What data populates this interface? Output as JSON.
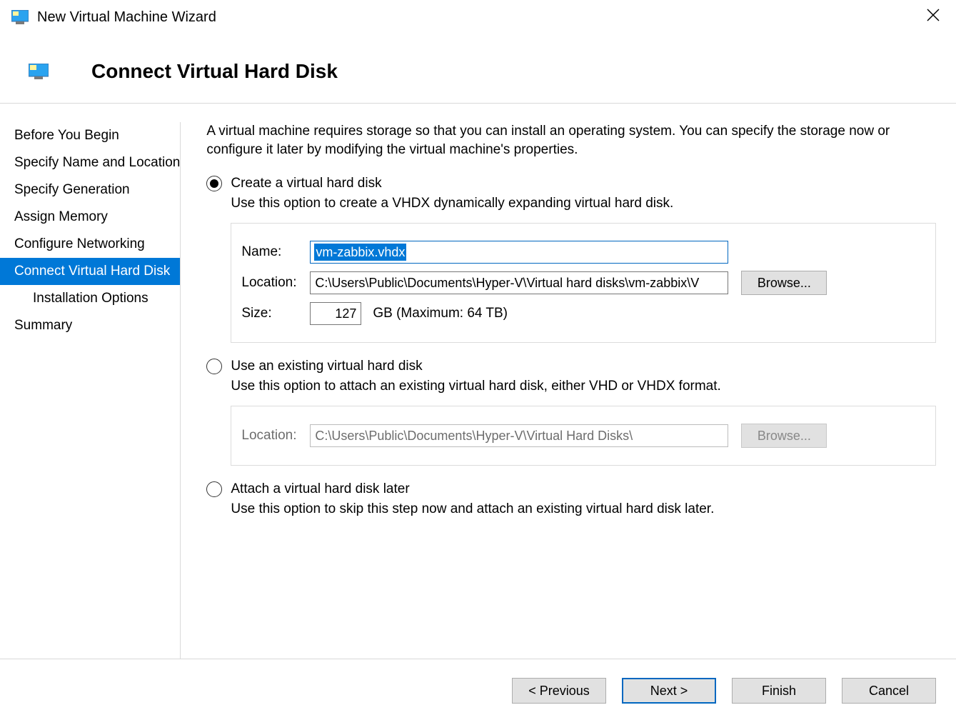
{
  "window": {
    "title": "New Virtual Machine Wizard"
  },
  "header": {
    "page_title": "Connect Virtual Hard Disk"
  },
  "sidebar": {
    "items": [
      "Before You Begin",
      "Specify Name and Location",
      "Specify Generation",
      "Assign Memory",
      "Configure Networking",
      "Connect Virtual Hard Disk",
      "Installation Options",
      "Summary"
    ],
    "selected_index": 5,
    "sub_index": 6
  },
  "content": {
    "intro": "A virtual machine requires storage so that you can install an operating system. You can specify the storage now or configure it later by modifying the virtual machine's properties.",
    "option1": {
      "label": "Create a virtual hard disk",
      "desc": "Use this option to create a VHDX dynamically expanding virtual hard disk.",
      "name_label": "Name:",
      "name_value": "vm-zabbix.vhdx",
      "location_label": "Location:",
      "location_value": "C:\\Users\\Public\\Documents\\Hyper-V\\Virtual hard disks\\vm-zabbix\\V",
      "browse_label": "Browse...",
      "size_label": "Size:",
      "size_value": "127",
      "size_hint": "GB (Maximum: 64 TB)"
    },
    "option2": {
      "label": "Use an existing virtual hard disk",
      "desc": "Use this option to attach an existing virtual hard disk, either VHD or VHDX format.",
      "location_label": "Location:",
      "location_value": "C:\\Users\\Public\\Documents\\Hyper-V\\Virtual Hard Disks\\",
      "browse_label": "Browse..."
    },
    "option3": {
      "label": "Attach a virtual hard disk later",
      "desc": "Use this option to skip this step now and attach an existing virtual hard disk later."
    }
  },
  "footer": {
    "previous": "< Previous",
    "next": "Next >",
    "finish": "Finish",
    "cancel": "Cancel"
  }
}
